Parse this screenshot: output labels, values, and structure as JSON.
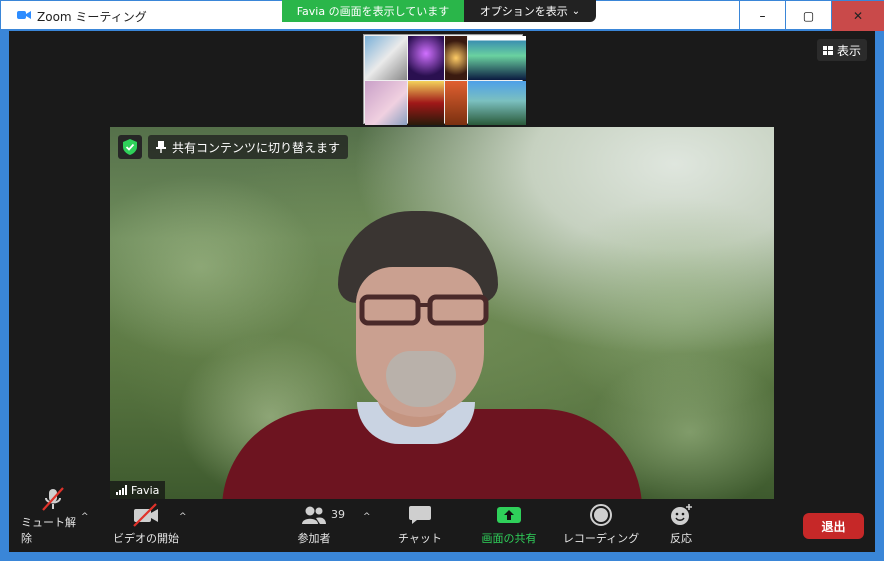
{
  "window": {
    "title": "Zoom ミーティング",
    "controls": {
      "minimize": "–",
      "maximize": "▢",
      "close": "✕"
    }
  },
  "share_banner": {
    "status": "Favia の画面を表示しています",
    "options": "オプションを表示",
    "options_chevron": "⌄",
    "status_color": "#2ab64a"
  },
  "view_button": {
    "label": "表示"
  },
  "video": {
    "pin_label": "共有コンテンツに切り替えます",
    "participant_name": "Favia"
  },
  "toolbar": {
    "mute": {
      "label": "ミュート解除",
      "icon": "mic-muted-icon"
    },
    "video": {
      "label": "ビデオの開始",
      "icon": "video-off-icon"
    },
    "participants": {
      "label": "参加者",
      "count": "39",
      "icon": "participants-icon"
    },
    "chat": {
      "label": "チャット",
      "icon": "chat-icon"
    },
    "share": {
      "label": "画面の共有",
      "icon": "share-screen-icon",
      "color": "#2fd05a"
    },
    "record": {
      "label": "レコーディング",
      "icon": "record-icon"
    },
    "reactions": {
      "label": "反応",
      "icon": "reaction-icon"
    },
    "leave": {
      "label": "退出",
      "color": "#c62828"
    }
  }
}
